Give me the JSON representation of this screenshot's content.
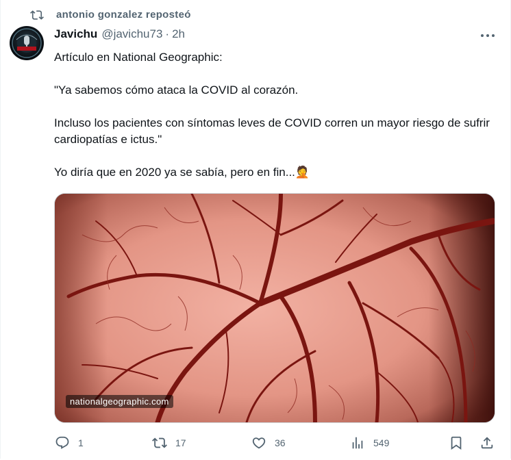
{
  "repost": {
    "text": "antonio gonzalez reposteó",
    "icon": "repost-icon"
  },
  "author": {
    "name": "Javichu",
    "handle": "@javichu73",
    "separator": "·",
    "time": "2h"
  },
  "body": {
    "line1": "Artículo en National Geographic:",
    "line2": "\"Ya sabemos cómo ataca la COVID al corazón.",
    "line3": "Incluso los pacientes con síntomas leves de COVID corren un mayor riesgo de sufrir cardiopatías e ictus.\"",
    "line4": "Yo diría que en 2020 ya se sabía, pero en fin...",
    "emoji": "🤦"
  },
  "media": {
    "caption": "nationalgeographic.com"
  },
  "actions": {
    "replies": "1",
    "reposts": "17",
    "likes": "36",
    "views": "549"
  },
  "colors": {
    "muted": "#536471",
    "text": "#0f1419",
    "border": "#cfd9de"
  }
}
